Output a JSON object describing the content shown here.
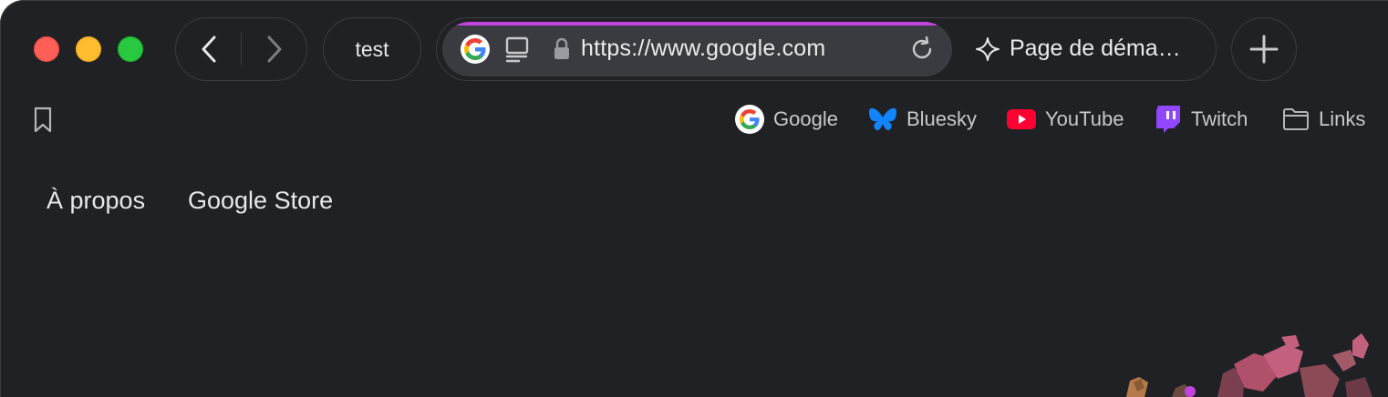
{
  "window": {
    "traffic_lights": [
      "close",
      "minimize",
      "maximize"
    ]
  },
  "navigation": {
    "back_icon": "chevron-left-icon",
    "forward_icon": "chevron-right-icon"
  },
  "tabs": {
    "pinned_tab_label": "test",
    "startpage_tab_label": "Page de déma…"
  },
  "address_bar": {
    "url": "https://www.google.com",
    "loading_progress": 0.97,
    "favicon": "google-g-icon",
    "progress_color": "#c244e0"
  },
  "new_tab_icon": "plus-icon",
  "bookmarks": [
    {
      "label": "Google",
      "icon": "google-icon"
    },
    {
      "label": "Bluesky",
      "icon": "bluesky-icon"
    },
    {
      "label": "YouTube",
      "icon": "youtube-icon"
    },
    {
      "label": "Twitch",
      "icon": "twitch-icon"
    },
    {
      "label": "Links",
      "icon": "folder-icon"
    }
  ],
  "page": {
    "nav_links": [
      "À propos",
      "Google Store"
    ]
  },
  "colors": {
    "background": "#202124",
    "accent": "#c244e0"
  }
}
